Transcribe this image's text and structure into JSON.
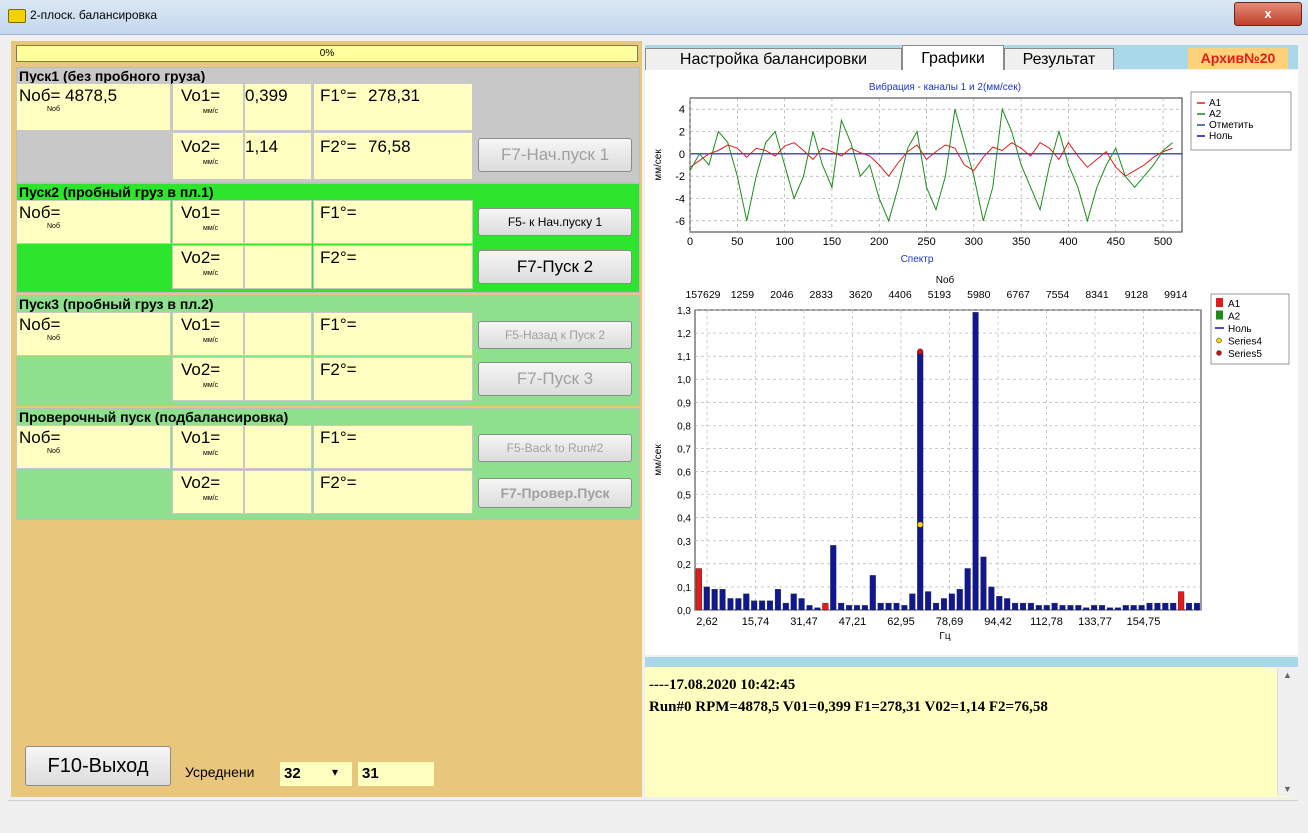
{
  "window": {
    "title": "2-плоск. балансировка",
    "close_label": "x"
  },
  "progress": {
    "label": "0%",
    "value": 0
  },
  "run1": {
    "title": "Пуск1 (без пробного груза)",
    "nob_label": "Nоб= 4878,5",
    "nob_sub": "Nоб",
    "vo1_label": "Vo1=",
    "vo1_value": "0,399",
    "vo1_sub": "мм/с",
    "f1_label": "F1°=",
    "f1_value": "278,31",
    "vo2_label": "Vo2=",
    "vo2_value": "1,14",
    "vo2_sub": "мм/с",
    "f2_label": "F2°=",
    "f2_value": "76,58",
    "btn_start": "F7-Нач.пуск 1"
  },
  "run2": {
    "title": "Пуск2 (пробный груз в пл.1)",
    "nob_label": "Nоб=",
    "nob_sub": "Nоб",
    "vo1_label": "Vo1=",
    "vo1_sub": "мм/с",
    "f1_label": "F1°=",
    "vo2_label": "Vo2=",
    "vo2_sub": "мм/с",
    "f2_label": "F2°=",
    "btn_back": "F5- к Нач.пуску 1",
    "btn_start": "F7-Пуск 2"
  },
  "run3": {
    "title": "Пуск3 (пробный груз в пл.2)",
    "nob_label": "Nоб=",
    "nob_sub": "Nоб",
    "vo1_label": "Vo1=",
    "vo1_sub": "мм/с",
    "f1_label": "F1°=",
    "vo2_label": "Vo2=",
    "vo2_sub": "мм/с",
    "f2_label": "F2°=",
    "btn_back": "F5-Назад к Пуск 2",
    "btn_start": "F7-Пуск 3"
  },
  "run4": {
    "title": "Проверочный пуск (подбалансировка)",
    "nob_label": "Nоб=",
    "nob_sub": "Nоб",
    "vo1_label": "Vo1=",
    "vo1_sub": "мм/с",
    "f1_label": "F1°=",
    "vo2_label": "Vo2=",
    "vo2_sub": "мм/с",
    "f2_label": "F2°=",
    "btn_back": "F5-Back to Run#2",
    "btn_start": "F7-Провер.Пуск"
  },
  "bottom": {
    "exit_label": "F10-Выход",
    "avg_label": "Усреднени",
    "avg_select": "32",
    "avg_value": "31"
  },
  "tabs": [
    "Настройка балансировки",
    "Графики",
    "Результат"
  ],
  "archive": "Архив№20",
  "colors": {
    "a1": "#e31b1b",
    "a2": "#1a8c1a",
    "mark": "#1f4e8c",
    "null": "#1010c8",
    "section_green": "#2ee52e",
    "section_light_green": "#8ee08e",
    "section_grey": "#c8c8c8",
    "left_bg": "#e8c67c",
    "cell_bg": "#ffffc2"
  },
  "chart_data": [
    {
      "type": "line",
      "title": "Вибрация - каналы 1 и 2(мм/сек)",
      "ylabel": "мм/сек",
      "xlim": [
        0,
        520
      ],
      "ylim": [
        -7,
        5
      ],
      "x_ticks": [
        "0",
        "50",
        "100",
        "150",
        "200",
        "250",
        "300",
        "350",
        "400",
        "450",
        "500"
      ],
      "y_ticks": [
        "4",
        "2",
        "0",
        "-2",
        "-4",
        "-6"
      ],
      "legend": [
        "A1",
        "A2",
        "Отметить",
        "Ноль"
      ],
      "series": [
        {
          "name": "A1",
          "x": [
            0,
            10,
            20,
            30,
            40,
            50,
            60,
            70,
            80,
            90,
            100,
            110,
            120,
            130,
            140,
            150,
            160,
            170,
            180,
            190,
            200,
            210,
            220,
            230,
            240,
            250,
            260,
            270,
            280,
            290,
            300,
            310,
            320,
            330,
            340,
            350,
            360,
            370,
            380,
            390,
            400,
            410,
            420,
            430,
            440,
            450,
            460,
            470,
            480,
            490,
            500,
            510
          ],
          "values": [
            -1.2,
            -0.6,
            0,
            0.3,
            0.8,
            0.5,
            -0.3,
            0.5,
            0.3,
            -0.2,
            0.7,
            1,
            0.3,
            -0.5,
            0.5,
            0.2,
            -0.2,
            0.5,
            0.1,
            -0.2,
            -1,
            -2,
            -0.8,
            0.2,
            0.8,
            -0.5,
            0.2,
            0.8,
            0.5,
            -1,
            -1.5,
            -0.3,
            0.6,
            0.3,
            1,
            0.5,
            -0.2,
            1,
            0.5,
            -0.5,
            1,
            -0.2,
            -1.2,
            -0.5,
            0.2,
            -1.2,
            -2,
            -1.5,
            -1,
            -0.3,
            0.2,
            0.5
          ]
        },
        {
          "name": "A2",
          "x": [
            0,
            10,
            20,
            30,
            40,
            50,
            60,
            70,
            80,
            90,
            100,
            110,
            120,
            130,
            140,
            150,
            160,
            170,
            180,
            190,
            200,
            210,
            220,
            230,
            240,
            250,
            260,
            270,
            280,
            290,
            300,
            310,
            320,
            330,
            340,
            350,
            360,
            370,
            380,
            390,
            400,
            410,
            420,
            430,
            440,
            450,
            460,
            470,
            480,
            490,
            500,
            510
          ],
          "values": [
            -1.5,
            0,
            -1,
            2,
            1,
            -2,
            -6,
            -2,
            1,
            2,
            -1,
            -4,
            -2,
            2,
            -1,
            -3,
            3,
            1,
            -2,
            -1,
            -4,
            -6,
            -3,
            0.5,
            2,
            -3,
            -5,
            -2,
            4,
            1,
            -2,
            -6,
            -3,
            4,
            2,
            -1,
            -3,
            -5,
            -1,
            2,
            -1,
            -3,
            -6,
            -3,
            -1,
            0.5,
            -2,
            -3,
            -2,
            -1,
            0.3,
            1
          ]
        }
      ]
    },
    {
      "type": "bar",
      "title": "Спектр",
      "xlabel": "Гц",
      "ylabel": "мм/сек",
      "top_axis_label": "Nоб",
      "top_ticks": [
        "157629",
        "1259",
        "2046",
        "2833",
        "3620",
        "4406",
        "5193",
        "5980",
        "6767",
        "7554",
        "8341",
        "9128",
        "9914"
      ],
      "bottom_ticks": [
        "2,62",
        "15,74",
        "31,47",
        "47,21",
        "62,95",
        "78,69",
        "94,42",
        "112,78",
        "133,77",
        "154,75"
      ],
      "y_ticks": [
        "1,3",
        "1,2",
        "1,1",
        "1,0",
        "0,9",
        "0,8",
        "0,7",
        "0,6",
        "0,5",
        "0,4",
        "0,3",
        "0,2",
        "0,1",
        "0,0"
      ],
      "ylim": [
        0,
        1.3
      ],
      "legend": [
        "A1",
        "A2",
        "Ноль",
        "Series4",
        "Series5"
      ],
      "series": [
        {
          "name": "A2",
          "values": [
            0.17,
            0.1,
            0.09,
            0.09,
            0.05,
            0.05,
            0.07,
            0.04,
            0.04,
            0.04,
            0.09,
            0.03,
            0.07,
            0.05,
            0.02,
            0.01,
            0.02,
            0.28,
            0.03,
            0.02,
            0.02,
            0.02,
            0.15,
            0.03,
            0.03,
            0.03,
            0.02,
            0.07,
            1.12,
            0.08,
            0.03,
            0.05,
            0.07,
            0.09,
            0.18,
            1.29,
            0.23,
            0.1,
            0.06,
            0.05,
            0.03,
            0.03,
            0.03,
            0.02,
            0.02,
            0.03,
            0.02,
            0.02,
            0.02,
            0.01,
            0.02,
            0.02,
            0.01,
            0.01,
            0.02,
            0.02,
            0.02,
            0.03,
            0.03,
            0.03,
            0.03,
            0.07,
            0.03,
            0.03
          ]
        },
        {
          "name": "A1",
          "values": [
            0.18,
            0,
            0,
            0,
            0,
            0,
            0,
            0,
            0,
            0,
            0,
            0,
            0,
            0,
            0,
            0,
            0.03,
            0,
            0,
            0,
            0,
            0,
            0,
            0,
            0,
            0,
            0,
            0,
            0,
            0,
            0,
            0,
            0,
            0,
            0,
            0,
            0,
            0,
            0,
            0,
            0,
            0,
            0,
            0,
            0,
            0,
            0,
            0,
            0,
            0,
            0,
            0,
            0,
            0,
            0,
            0,
            0,
            0,
            0,
            0,
            0,
            0.08,
            0,
            0
          ]
        }
      ],
      "markers": [
        {
          "name": "Series4",
          "bin": 28,
          "value": 0.37
        },
        {
          "name": "Series5",
          "bin": 28,
          "value": 1.12
        }
      ]
    }
  ],
  "log": {
    "line1": "----17.08.2020 10:42:45",
    "line2": "Run#0 RPM=4878,5 V01=0,399 F1=278,31 V02=1,14 F2=76,58"
  }
}
